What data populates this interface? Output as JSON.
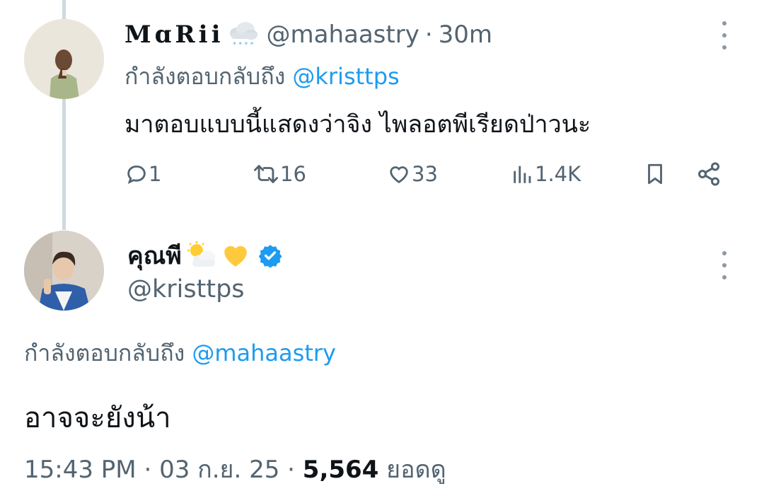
{
  "reply_tweet": {
    "display_name": "MɑRii",
    "name_emoji": "snow-cloud-icon",
    "handle": "@mahaastry",
    "separator": "·",
    "time": "30m",
    "replying_to_label": "กำลังตอบกลับถึง",
    "replying_to_handle": "@kristtps",
    "text": "มาตอบแบบนี้แสดงว่าจิง ไพลอตพีเรียดป่าวนะ",
    "replies": "1",
    "retweets": "16",
    "likes": "33",
    "views": "1.4K"
  },
  "main_tweet": {
    "display_name": "คุณพี",
    "name_emojis": [
      "sun-behind-cloud-icon",
      "yellow-heart-icon",
      "verified-badge-icon"
    ],
    "handle": "@kristtps",
    "replying_to_label": "กำลังตอบกลับถึง",
    "replying_to_handle": "@mahaastry",
    "text": "อาจจะยังน้า",
    "time": "15:43 PM",
    "date": "03 ก.ย. 25",
    "sep1": "·",
    "sep2": "·",
    "views": "5,564",
    "views_label": "ยอดดู"
  },
  "colors": {
    "accent": "#1d9bf0",
    "secondary_text": "#536471",
    "primary_text": "#0f1419",
    "thread_line": "#cfd9de",
    "heart": "#ffc93c"
  }
}
